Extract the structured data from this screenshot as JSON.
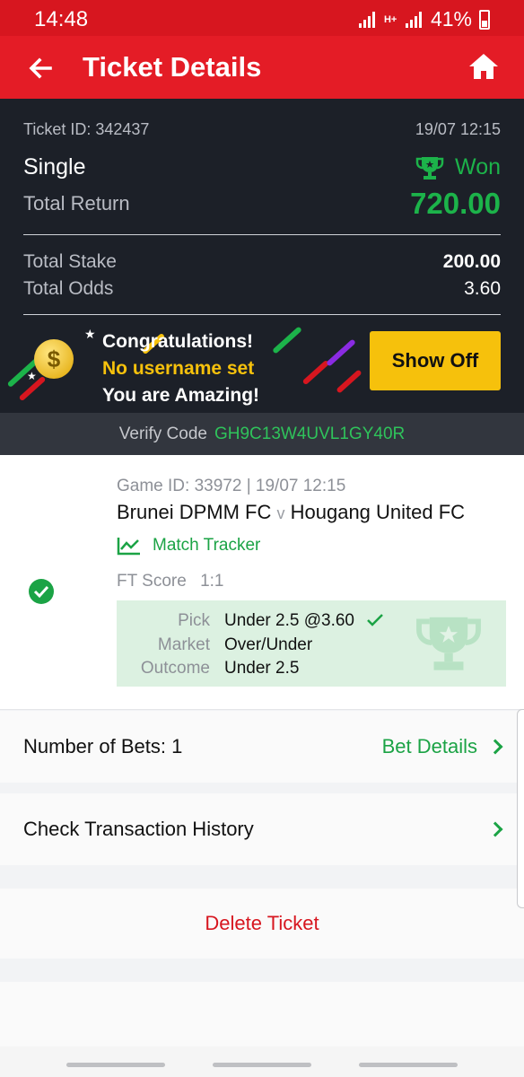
{
  "status_bar": {
    "time": "14:48",
    "network_label": "H+",
    "battery": "41%"
  },
  "app_bar": {
    "title": "Ticket Details",
    "back_icon": "arrow-left-icon",
    "home_icon": "home-icon"
  },
  "ticket": {
    "id_label": "Ticket ID: 342437",
    "datetime": "19/07 12:15",
    "bet_type": "Single",
    "status": "Won",
    "total_return_label": "Total Return",
    "total_return": "720.00",
    "total_stake_label": "Total Stake",
    "total_stake": "200.00",
    "total_odds_label": "Total Odds",
    "total_odds": "3.60"
  },
  "congrats": {
    "line1": "Congratulations!",
    "line2": "No username set",
    "line3": "You are Amazing!",
    "show_off_label": "Show Off",
    "coin_symbol": "$"
  },
  "verify": {
    "label": "Verify Code",
    "code": "GH9C13W4UVL1GY40R"
  },
  "game": {
    "meta": "Game ID: 33972 | 19/07 12:15",
    "home_team": "Brunei DPMM FC",
    "vs": "v",
    "away_team": "Hougang United FC",
    "tracker_label": "Match Tracker",
    "ft_score_label": "FT Score",
    "ft_score": "1:1",
    "pick_label": "Pick",
    "pick_value": "Under 2.5 @3.60",
    "market_label": "Market",
    "market_value": "Over/Under",
    "outcome_label": "Outcome",
    "outcome_value": "Under 2.5"
  },
  "bets_row": {
    "label": "Number of Bets: 1",
    "details_label": "Bet Details"
  },
  "history_row": {
    "label": "Check Transaction History"
  },
  "delete": {
    "label": "Delete Ticket"
  },
  "colors": {
    "brand_red": "#e41c26",
    "win_green": "#1cb34a",
    "dark_bg": "#1c2028",
    "gold": "#f6c10c"
  }
}
